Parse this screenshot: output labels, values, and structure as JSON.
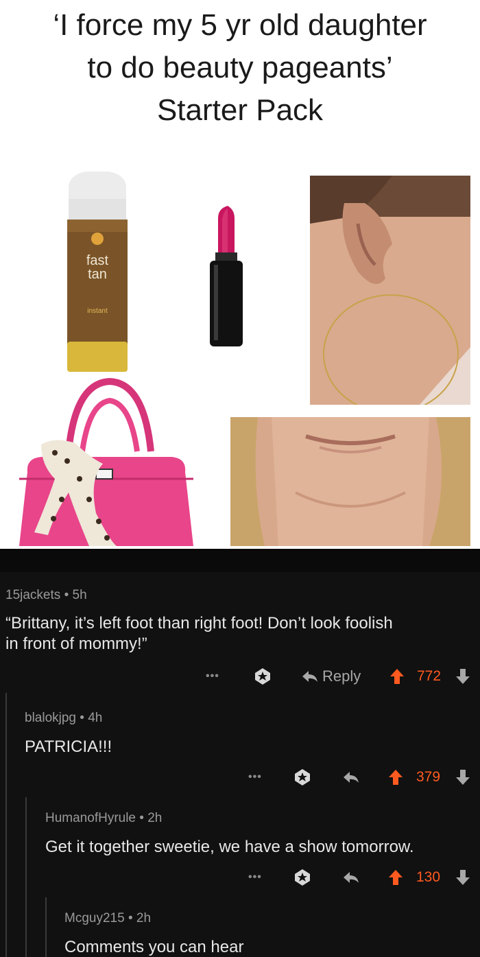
{
  "meme": {
    "title_lines": [
      "‘I force my 5  yr old daughter",
      "to do beauty pageants’",
      "Starter Pack"
    ],
    "can": {
      "brand_line_1": "fast",
      "brand_line_2": "tan",
      "instant": "instant"
    }
  },
  "comments": [
    {
      "author": "15jackets",
      "time": "5h",
      "text_line_1": "“Brittany, it’s left foot than right foot! Don’t look foolish",
      "text_line_2": "in front of mommy!”",
      "reply_label": "Reply",
      "score": "772"
    },
    {
      "author": "blalokjpg",
      "time": "4h",
      "text": "PATRICIA!!!",
      "score": "379"
    },
    {
      "author": "HumanofHyrule",
      "time": "2h",
      "text": "Get it together sweetie, we have a show tomorrow.",
      "score": "130"
    },
    {
      "author": "Mcguy215",
      "time": "2h",
      "text": "Comments you can hear"
    }
  ],
  "colors": {
    "thread_bg": "#111111",
    "upvote_orange": "#ff5a1f",
    "lipstick_pink": "#c8175f",
    "bag_pink": "#e8458a"
  },
  "icons": [
    "more-icon",
    "award-icon",
    "reply-icon",
    "upvote-icon",
    "downvote-icon"
  ],
  "separator": "•"
}
